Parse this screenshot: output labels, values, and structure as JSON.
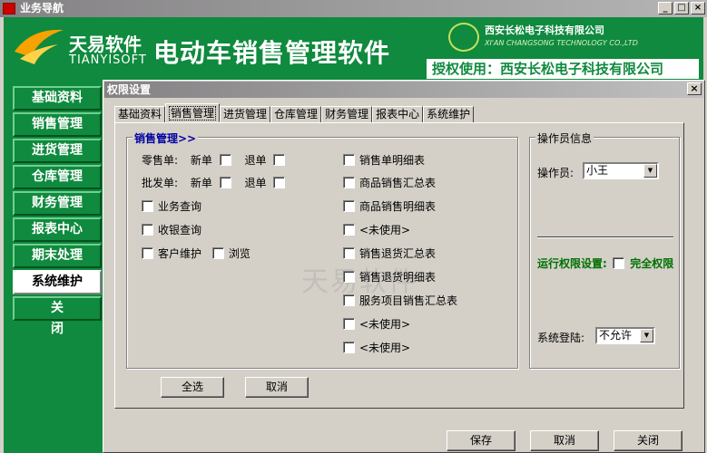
{
  "window": {
    "title": "业务导航",
    "min": "_",
    "max": "□",
    "close": "×"
  },
  "banner": {
    "logo_cn": "天易软件",
    "logo_en": "TIANYISOFT",
    "system_title": "电动车销售管理软件",
    "company_cn": "西安长松电子科技有限公司",
    "company_en": "XI'AN CHANGSONG TECHNOLOGY CO.,LTD",
    "license": "授权使用：西安长松电子科技有限公司"
  },
  "sidebar": {
    "items": [
      {
        "label": "基础资料"
      },
      {
        "label": "销售管理"
      },
      {
        "label": "进货管理"
      },
      {
        "label": "仓库管理"
      },
      {
        "label": "财务管理"
      },
      {
        "label": "报表中心"
      },
      {
        "label": "期末处理"
      },
      {
        "label": "系统维护"
      },
      {
        "label": "关闭"
      }
    ]
  },
  "dialog": {
    "title": "权限设置",
    "close": "×",
    "tabs": [
      "基础资料",
      "销售管理",
      "进货管理",
      "仓库管理",
      "财务管理",
      "报表中心",
      "系统维护"
    ],
    "active_tab": "销售管理",
    "watermark": "天易软件",
    "sales_group": {
      "title": "销售管理>>",
      "retail_label": "零售单:",
      "wholesale_label": "批发单:",
      "new_label": "新单",
      "return_label": "退单",
      "left_checks": [
        "业务查询",
        "收银查询"
      ],
      "customer_label": "客户维护",
      "browse_label": "浏览",
      "right_checks": [
        "销售单明细表",
        "商品销售汇总表",
        "商品销售明细表",
        "<未使用>",
        "销售退货汇总表",
        "销售退货明细表",
        "服务项目销售汇总表",
        "<未使用>",
        "<未使用>"
      ]
    },
    "operator_group": {
      "title": "操作员信息",
      "operator_label": "操作员:",
      "operator_value": "小王",
      "run_perm_label": "运行权限设置:",
      "full_perm_label": "完全权限",
      "login_label": "系统登陆:",
      "login_value": "不允许"
    },
    "buttons": {
      "select_all": "全选",
      "cancel_sel": "取消",
      "save": "保存",
      "cancel": "取消",
      "close": "关闭"
    }
  }
}
